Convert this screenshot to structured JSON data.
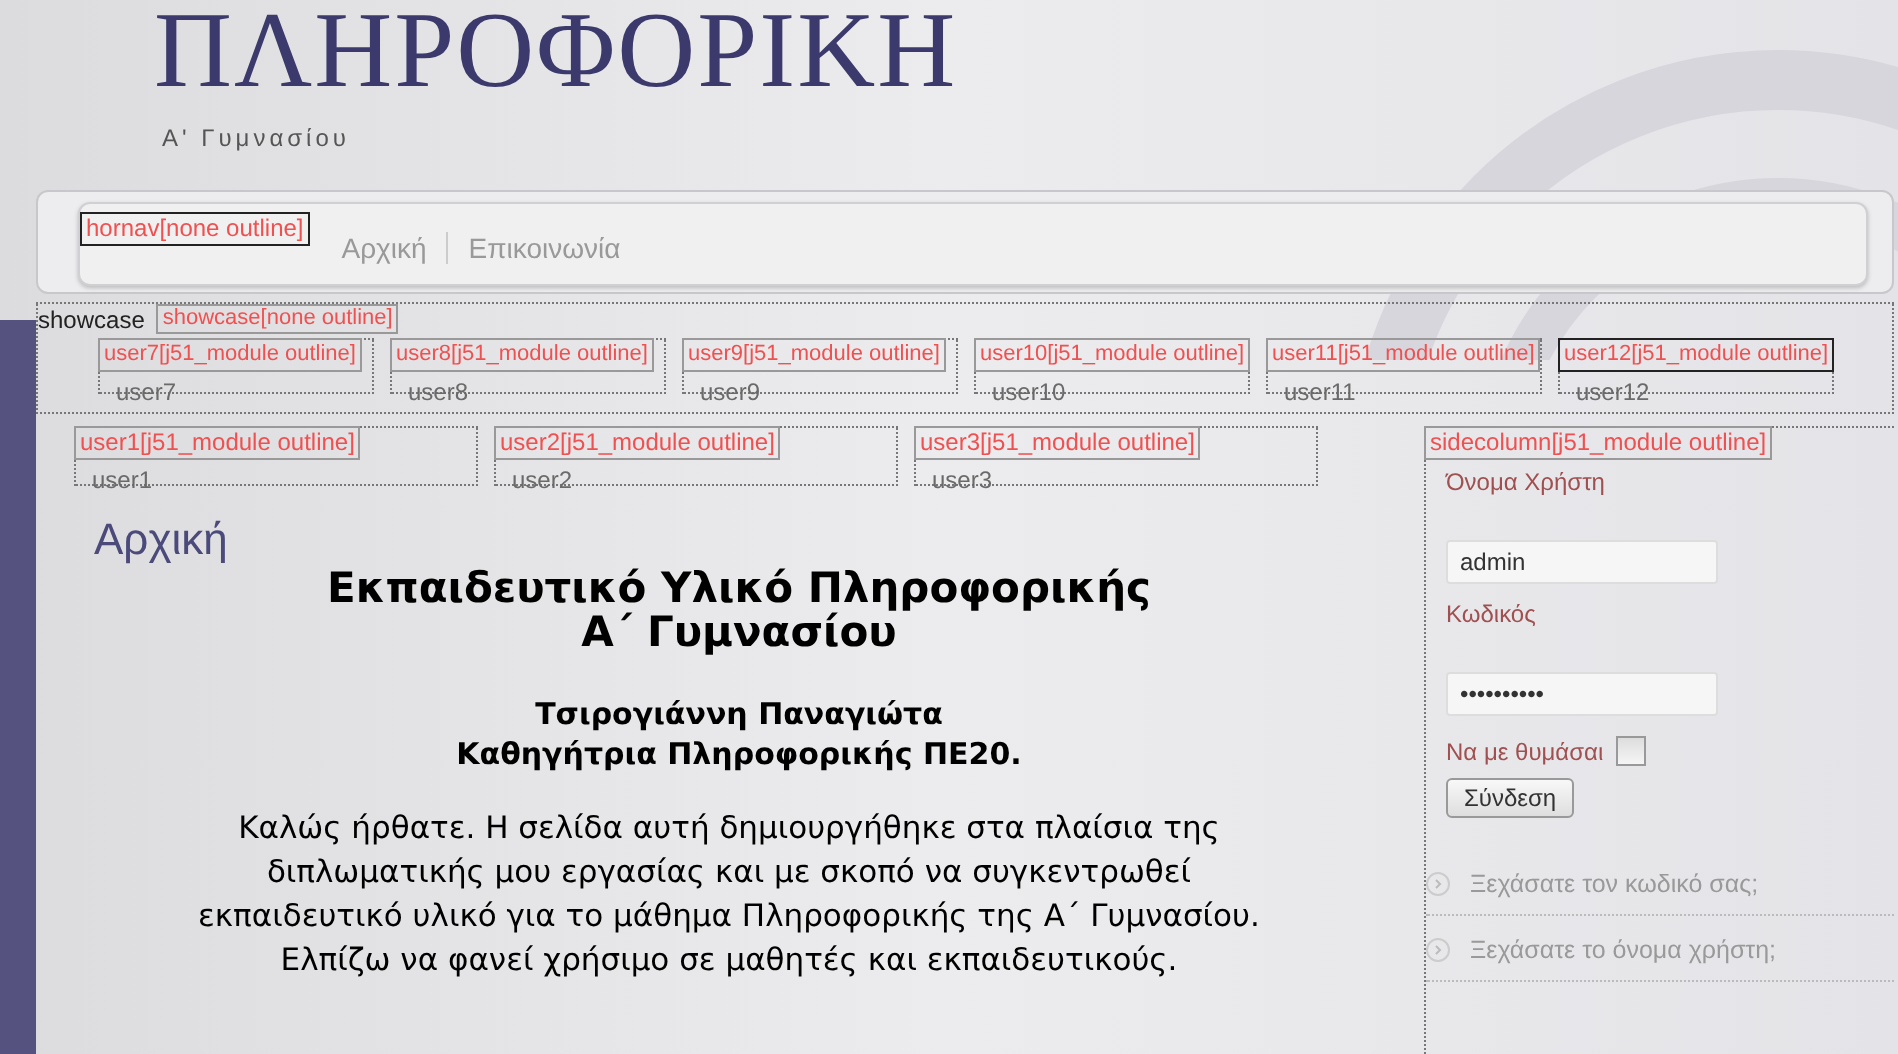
{
  "header": {
    "title": "ΠΛΗΡΟΦΟΡΙΚΗ",
    "subtitle": "Α' Γυμνασίου"
  },
  "nav": {
    "outline_label": "hornav[none outline]",
    "items": [
      {
        "label": "Αρχική"
      },
      {
        "label": "Επικοινωνία"
      }
    ]
  },
  "showcase": {
    "caption": "showcase",
    "outline_label": "showcase[none outline]"
  },
  "top_modules": [
    {
      "outline_label": "user7[j51_module outline]",
      "position": "user7"
    },
    {
      "outline_label": "user8[j51_module outline]",
      "position": "user8"
    },
    {
      "outline_label": "user9[j51_module outline]",
      "position": "user9"
    },
    {
      "outline_label": "user10[j51_module outline]",
      "position": "user10"
    },
    {
      "outline_label": "user11[j51_module outline]",
      "position": "user11"
    },
    {
      "outline_label": "user12[j51_module outline]",
      "position": "user12"
    }
  ],
  "content_modules": [
    {
      "outline_label": "user1[j51_module outline]",
      "position": "user1"
    },
    {
      "outline_label": "user2[j51_module outline]",
      "position": "user2"
    },
    {
      "outline_label": "user3[j51_module outline]",
      "position": "user3"
    }
  ],
  "article": {
    "heading": "Αρχική",
    "title_lines": [
      "Εκπαιδευτικό Υλικό Πληροφορικής",
      "Α΄ Γυμνασίου"
    ],
    "author_lines": [
      "Τσιρογιάννη Παναγιώτα",
      "Καθηγήτρια Πληροφορικής ΠΕ20."
    ],
    "body": "Καλώς ήρθατε. Η σελίδα αυτή δημιουργήθηκε στα πλαίσια της διπλωματικής μου εργασίας και με σκοπό να συγκεντρωθεί εκπαιδευτικό υλικό για το μάθημα Πληροφορικής της Α΄ Γυμνασίου. Ελπίζω να φανεί χρήσιμο σε μαθητές και εκπαιδευτικούς."
  },
  "login": {
    "outline_label": "sidecolumn[j51_module outline]",
    "username_label": "Όνομα Χρήστη",
    "username_value": "admin",
    "password_label": "Κωδικός",
    "password_value": "••••••••••",
    "remember_label": "Να με θυμάσαι",
    "remember_checked": false,
    "submit": "Σύνδεση",
    "links": [
      "Ξεχάσατε τον κωδικό σας;",
      "Ξεχάσατε το όνομα χρήστη;"
    ]
  }
}
